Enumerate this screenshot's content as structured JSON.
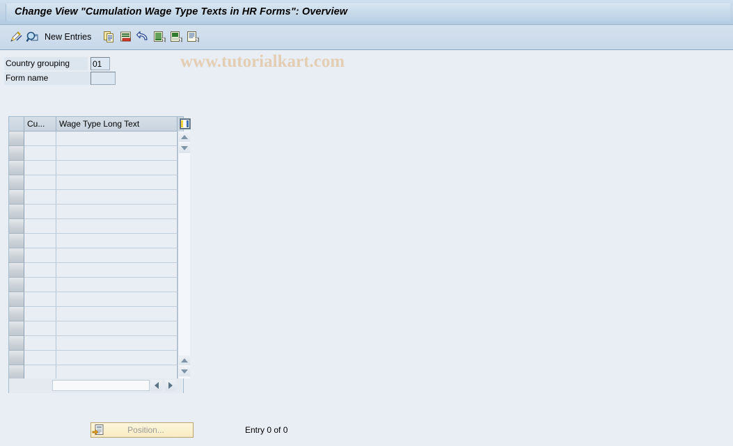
{
  "window": {
    "title": "Change View \"Cumulation Wage Type Texts in HR Forms\": Overview"
  },
  "toolbar": {
    "icons": [
      {
        "name": "display-change-icon",
        "title": "Display <-> Change"
      },
      {
        "name": "magnifier-details-icon",
        "title": "Display details"
      },
      {
        "name": "copy-icon",
        "title": "Copy as..."
      },
      {
        "name": "delete-row-icon",
        "title": "Delete"
      },
      {
        "name": "undo-icon",
        "title": "Undo change"
      },
      {
        "name": "select-all-icon",
        "title": "Select all"
      },
      {
        "name": "select-block-icon",
        "title": "Select block"
      },
      {
        "name": "deselect-all-icon",
        "title": "Deselect all"
      }
    ],
    "new_entries_label": "New Entries"
  },
  "watermark": {
    "text": "www.tutorialkart.com"
  },
  "form": {
    "fields": [
      {
        "label": "Country grouping",
        "value": "01",
        "placeholder": ""
      },
      {
        "label": "Form name",
        "value": "",
        "placeholder": ""
      }
    ]
  },
  "table": {
    "columns": [
      {
        "key": "cu",
        "label": "Cu..."
      },
      {
        "key": "wage_type_long_text",
        "label": "Wage Type Long Text"
      }
    ],
    "settings_icon": "table-settings-icon",
    "rows": [],
    "visible_empty_rows": 17,
    "scroll": {
      "up_arrow": "scroll-up-arrow",
      "down_arrow": "scroll-down-arrow",
      "left_arrow": "scroll-left-arrow",
      "right_arrow": "scroll-right-arrow"
    }
  },
  "footer": {
    "position_button": {
      "label": "Position...",
      "icon": "position-icon",
      "enabled": false
    },
    "entry_status": "Entry 0 of 0"
  },
  "colors": {
    "titlebar_gradient_top": "#cfe0ee",
    "titlebar_gradient_bottom": "#b2cbe1",
    "toolbar_bg": "#cddcec",
    "page_bg": "#e9edf4",
    "field_bg": "#dce7f1",
    "table_header_bg": "#ccd6e0",
    "table_cell_bg": "#e9eef5",
    "row_selector_bg": "#ccd2d8",
    "button_yellow": "#f8ecc3",
    "watermark": "#e3c9a8"
  }
}
